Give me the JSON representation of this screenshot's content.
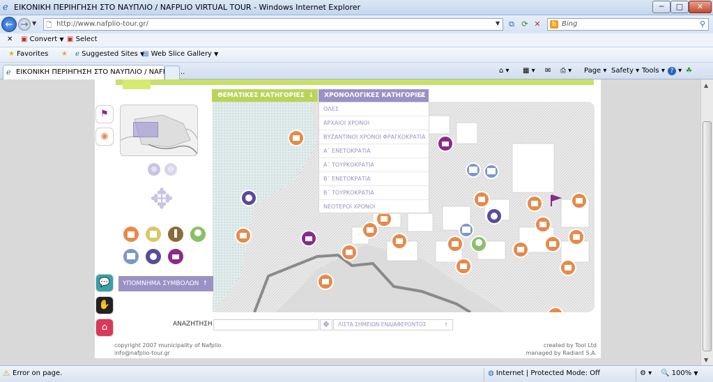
{
  "window": {
    "title": "ΕΙΚΟΝΙΚΗ ΠΕΡΙΗΓΗΣΗ ΣΤΟ ΝΑΥΠΛΙΟ / NAFPLIO VIRTUAL TOUR - Windows Internet Explorer",
    "minimize": "─",
    "maximize": "□",
    "close": "✕"
  },
  "address_bar": {
    "url": "http://www.nafplio-tour.gr/",
    "search_placeholder": "Bing"
  },
  "command_bar": {
    "close": "✕",
    "convert": "Convert",
    "select": "Select"
  },
  "favorites_bar": {
    "favorites": "Favorites",
    "suggested_sites": "Suggested Sites",
    "web_slice_gallery": "Web Slice Gallery"
  },
  "tab": {
    "title": "ΕΙΚΟΝΙΚΗ ΠΕΡΙΗΓΗΣΗ ΣΤΟ ΝΑΥΠΛΙΟ / NAFPLIO..."
  },
  "tools": {
    "page": "Page",
    "safety": "Safety",
    "tools": "Tools",
    "help": "?"
  },
  "site": {
    "thematic_categories": "ΘΕΜΑΤΙΚΕΣ ΚΑΤΗΓΟΡΙΕΣ",
    "chronological_categories": "ΧΡΟΝΟΛΟΓΙΚΕΣ ΚΑΤΗΓΟΡΙΕΣ",
    "chrono_options": [
      "ΟΛΕΣ",
      "ΑΡΧΑΙΟΙ ΧΡΟΝΟΙ",
      "ΒΥΖΑΝΤΙΝΟΙ ΧΡΟΝΟΙ ΦΡΑΓΚΟΚΡΑΤΙΑ",
      "Α΄ ΕΝΕΤΟΚΡΑΤΙΑ",
      "Α΄ ΤΟΥΡΚΟΚΡΑΤΙΑ",
      "Β΄ ΕΝΕΤΟΚΡΑΤΙΑ",
      "Β΄ ΤΟΥΡΚΟΚΡΑΤΙΑ",
      "ΝΕΟΤΕΡΟΙ ΧΡΟΝΟΙ"
    ],
    "legend": "ΥΠΟΜΝΗΜΑ ΣΥΜΒΟΛΩΝ",
    "search_label": "ΑΝΑΖΗΤΗΣΗ",
    "poi_list": "ΛΙΣΤΑ ΣΗΜΕΙΩΝ ΕΝΔΙΑΦΕΡΟΝΤΟΣ",
    "footer_left_1": "copyright 2007 municipality of Nafplio",
    "footer_left_2": "info@nafplio-tour.gr",
    "footer_right_1": "created by Tool Ltd",
    "footer_right_2": "managed by Radiant S.A."
  },
  "colors": {
    "accent_green": "#b8d45a",
    "accent_purple": "#9a91c4",
    "poi_orange": "#e8894a",
    "poi_blue": "#7b98c8",
    "poi_violet": "#8a2a8a"
  },
  "status_bar": {
    "text": "Error on page.",
    "zone": "Internet | Protected Mode: Off",
    "zoom": "100%"
  }
}
